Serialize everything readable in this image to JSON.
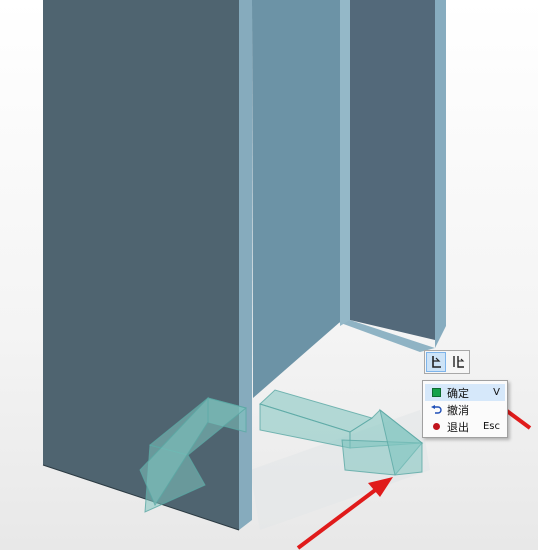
{
  "colors": {
    "steel_dark": "#4f6470",
    "steel_mid": "#5f7a88",
    "steel_light": "#7ea3b5",
    "ghost_fill": "#7fc4c0",
    "annotation_arrow": "#e01b1b"
  },
  "toolbar": {
    "buttons": [
      {
        "icon": "fillet-corner-icon",
        "state": "active"
      },
      {
        "icon": "mirror-corner-icon",
        "state": "normal"
      }
    ]
  },
  "context_menu": {
    "items": [
      {
        "icon": "green-square-icon",
        "label": "确定",
        "shortcut": "V"
      },
      {
        "icon": "undo-arrow-icon",
        "label": "撤消",
        "shortcut": ""
      },
      {
        "icon": "red-dot-icon",
        "label": "退出",
        "shortcut": "Esc"
      }
    ]
  }
}
